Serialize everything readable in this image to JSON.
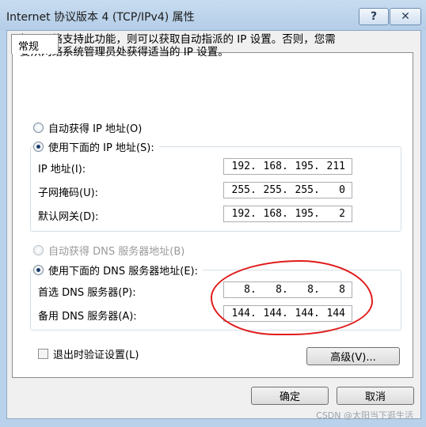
{
  "window": {
    "title": "Internet 协议版本 4 (TCP/IPv4) 属性",
    "help_label": "?",
    "close_label": "✕"
  },
  "tab": {
    "label": "常规"
  },
  "description": {
    "line1": "如果网络支持此功能，则可以获取自动指派的 IP 设置。否则，您需",
    "line2": "要从网络系统管理员处获得适当的 IP 设置。"
  },
  "ip_mode": {
    "auto_label": "自动获得 IP 地址(O)",
    "manual_label": "使用下面的 IP 地址(S):",
    "selected": "manual"
  },
  "ip_fields": {
    "ip_label": "IP 地址(I):",
    "ip_value": [
      "192",
      "168",
      "195",
      "211"
    ],
    "mask_label": "子网掩码(U):",
    "mask_value": [
      "255",
      "255",
      "255",
      "0"
    ],
    "gateway_label": "默认网关(D):",
    "gateway_value": [
      "192",
      "168",
      "195",
      "2"
    ]
  },
  "dns_mode": {
    "auto_label": "自动获得 DNS 服务器地址(B)",
    "manual_label": "使用下面的 DNS 服务器地址(E):",
    "selected": "manual"
  },
  "dns_fields": {
    "preferred_label": "首选 DNS 服务器(P):",
    "preferred_value": [
      "8",
      "8",
      "8",
      "8"
    ],
    "alternate_label": "备用 DNS 服务器(A):",
    "alternate_value": [
      "144",
      "144",
      "144",
      "144"
    ]
  },
  "validate": {
    "label": "退出时验证设置(L)",
    "checked": false
  },
  "buttons": {
    "advanced": "高级(V)...",
    "ok": "确定",
    "cancel": "取消"
  },
  "watermark": "CSDN @太阳当下逛生活",
  "colors": {
    "annotation": "#e11b1b",
    "titlebar": "#b9d1ea"
  }
}
